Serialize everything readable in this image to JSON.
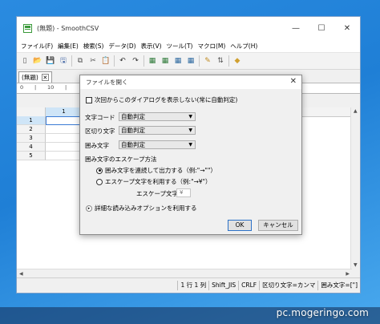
{
  "window": {
    "title": "(無題) - SmoothCSV",
    "min_symbol": "—",
    "max_symbol": "☐",
    "close_symbol": "✕"
  },
  "menu": [
    {
      "label": "ファイル(F)"
    },
    {
      "label": "編集(E)"
    },
    {
      "label": "検索(S)"
    },
    {
      "label": "データ(D)"
    },
    {
      "label": "表示(V)"
    },
    {
      "label": "ツール(T)"
    },
    {
      "label": "マクロ(M)"
    },
    {
      "label": "ヘルプ(H)"
    }
  ],
  "toolbar": {
    "icons": [
      "new-file-icon",
      "open-folder-icon",
      "save-icon",
      "save-all-icon",
      "copy-icon",
      "cut-icon",
      "paste-icon",
      "undo-icon",
      "redo-icon",
      "insert-row-icon",
      "insert-column-icon",
      "delete-row-icon",
      "delete-column-icon",
      "edit-icon",
      "sort-icon",
      "bookmark-icon"
    ],
    "glyphs": [
      "▯",
      "📂",
      "💾",
      "🖫",
      "⧉",
      "✂",
      "📋",
      "↶",
      "↷",
      "▦",
      "▦",
      "▦",
      "▦",
      "✎",
      "⇅",
      "◆"
    ]
  },
  "tab": {
    "label": "(無題)",
    "close_symbol": "✕"
  },
  "ruler": {
    "labels": [
      "0",
      "|",
      "10",
      "|"
    ]
  },
  "grid": {
    "column_headers": [
      "1"
    ],
    "row_headers": [
      "1",
      "2",
      "3",
      "4",
      "5"
    ],
    "selected_row": "1"
  },
  "status": {
    "position": "1 行 1 列",
    "encoding": "Shift_JIS",
    "line_ending": "CRLF",
    "delimiter": "区切り文字=カンマ",
    "quote": "囲み文字=[\"]"
  },
  "dialog": {
    "title": "ファイルを開く",
    "close_symbol": "✕",
    "dont_show_label": "次回からこのダイアログを表示しない(常に自動判定)",
    "dont_show_checked": false,
    "fields": [
      {
        "label": "文字コード",
        "value": "自動判定"
      },
      {
        "label": "区切り文字",
        "value": "自動判定"
      },
      {
        "label": "囲み文字",
        "value": "自動判定"
      }
    ],
    "escape_group_label": "囲み文字のエスケープ方法",
    "escape_option_1": "囲み文字を連続して出力する（例:\"→\"\"）",
    "escape_option_2": "エスケープ文字を利用する（例:\"→¥\"）",
    "escape_selected": 1,
    "escape_char_label": "エスケープ文字",
    "escape_char_value": "¥",
    "advanced_label": "詳細な読み込みオプションを利用する",
    "ok_label": "OK",
    "cancel_label": "キャンセル"
  },
  "watermark": "pc.mogeringo.com"
}
